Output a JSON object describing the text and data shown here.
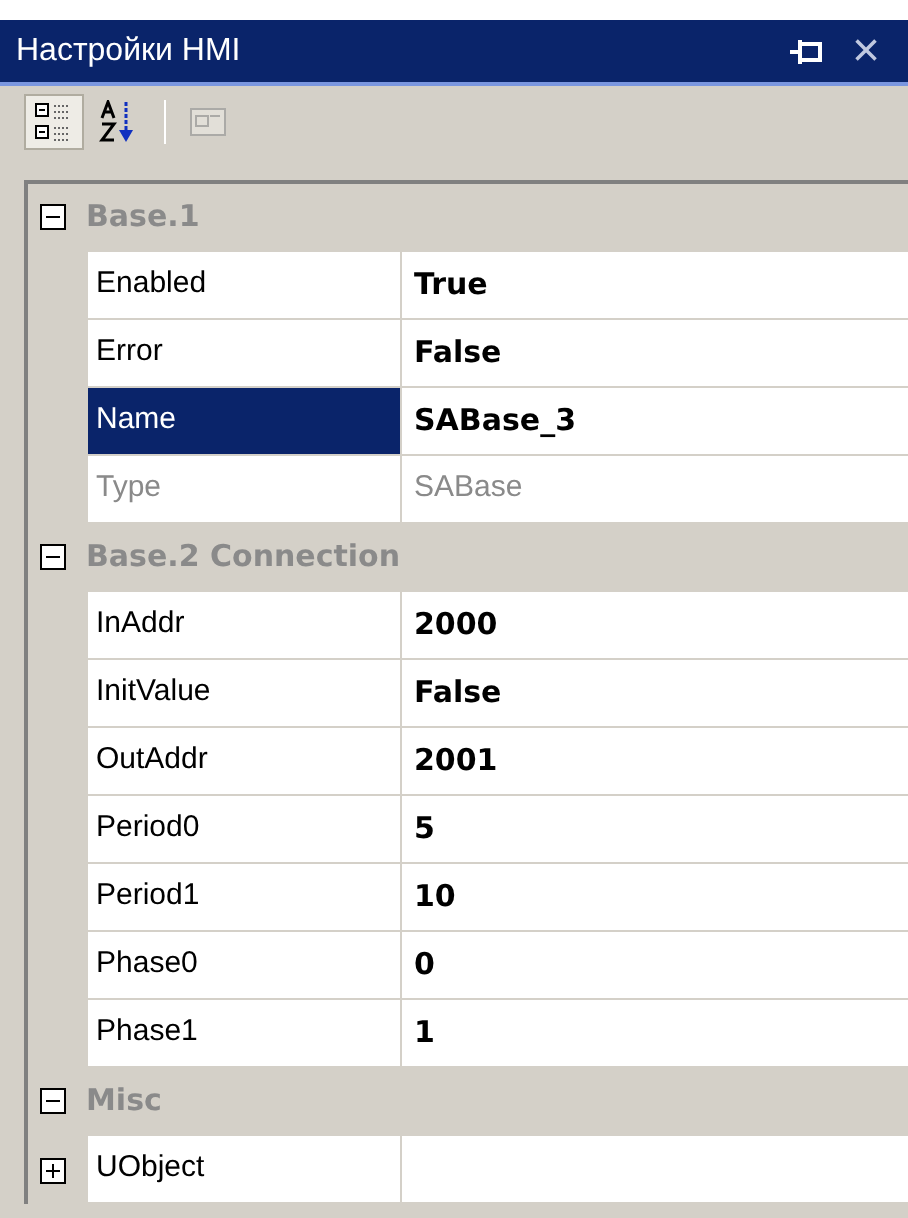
{
  "window": {
    "title": "Настройки HMI",
    "close_glyph": "×"
  },
  "toolbar": [
    {
      "kind": "categorized",
      "selected": true,
      "disabled": false
    },
    {
      "kind": "alphabetical",
      "selected": false,
      "disabled": false
    },
    {
      "kind": "pages",
      "selected": false,
      "disabled": true
    }
  ],
  "categories": [
    {
      "name": "Base.1",
      "expanded": true,
      "properties": [
        {
          "name": "Enabled",
          "value": "True",
          "selected": false,
          "disabled": false
        },
        {
          "name": "Error",
          "value": "False",
          "selected": false,
          "disabled": false
        },
        {
          "name": "Name",
          "value": "SABase_3",
          "selected": true,
          "disabled": false
        },
        {
          "name": "Type",
          "value": "SABase",
          "selected": false,
          "disabled": true
        }
      ]
    },
    {
      "name": "Base.2 Connection",
      "expanded": true,
      "properties": [
        {
          "name": "InAddr",
          "value": "2000",
          "selected": false,
          "disabled": false
        },
        {
          "name": "InitValue",
          "value": "False",
          "selected": false,
          "disabled": false
        },
        {
          "name": "OutAddr",
          "value": "2001",
          "selected": false,
          "disabled": false
        },
        {
          "name": "Period0",
          "value": "5",
          "selected": false,
          "disabled": false
        },
        {
          "name": "Period1",
          "value": "10",
          "selected": false,
          "disabled": false
        },
        {
          "name": "Phase0",
          "value": "0",
          "selected": false,
          "disabled": false
        },
        {
          "name": "Phase1",
          "value": "1",
          "selected": false,
          "disabled": false
        }
      ]
    },
    {
      "name": "Misc",
      "expanded": true,
      "properties": [
        {
          "name": "UObject",
          "selected": false,
          "disabled": false,
          "expanded": false
        }
      ]
    }
  ]
}
